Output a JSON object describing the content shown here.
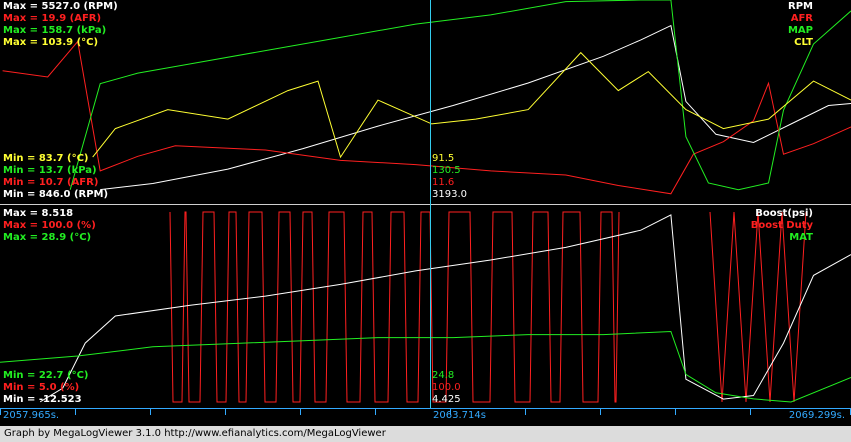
{
  "footer": {
    "text": "Graph by MegaLogViewer 3.1.0 http://www.efianalytics.com/MegaLogViewer"
  },
  "timeline": {
    "start": "2057.965s.",
    "cursor": "2063.714s",
    "end": "2069.299s."
  },
  "top_panel": {
    "max_labels": [
      {
        "text": "Max = 5527.0 (RPM)",
        "color": "#ffffff"
      },
      {
        "text": "Max = 19.9 (AFR)",
        "color": "#ff2020"
      },
      {
        "text": "Max = 158.7 (kPa)",
        "color": "#22ee22"
      },
      {
        "text": "Max = 103.9 (°C)",
        "color": "#ffff33"
      }
    ],
    "min_labels": [
      {
        "text": "Min = 83.7 (°C)",
        "color": "#ffff33"
      },
      {
        "text": "Min = 13.7 (kPa)",
        "color": "#22ee22"
      },
      {
        "text": "Min = 10.7 (AFR)",
        "color": "#ff2020"
      },
      {
        "text": "Min = 846.0 (RPM)",
        "color": "#ffffff"
      }
    ],
    "legend": [
      {
        "text": "RPM",
        "color": "#ffffff"
      },
      {
        "text": "AFR",
        "color": "#ff2020"
      },
      {
        "text": "MAP",
        "color": "#22ee22"
      },
      {
        "text": "CLT",
        "color": "#ffff33"
      }
    ],
    "cursor_values": [
      {
        "text": "91.5",
        "color": "#ffff33"
      },
      {
        "text": "130.5",
        "color": "#22ee22"
      },
      {
        "text": "11.6",
        "color": "#ff2020"
      },
      {
        "text": "3193.0",
        "color": "#ffffff"
      }
    ]
  },
  "bottom_panel": {
    "max_labels": [
      {
        "text": "Max = 8.518",
        "color": "#ffffff"
      },
      {
        "text": "Max = 100.0 (%)",
        "color": "#ff2020"
      },
      {
        "text": "Max = 28.9 (°C)",
        "color": "#22ee22"
      }
    ],
    "min_labels": [
      {
        "text": "Min = 22.7 (°C)",
        "color": "#22ee22"
      },
      {
        "text": "Min = 5.0 (%)",
        "color": "#ff2020"
      },
      {
        "text": "Min = -12.523",
        "color": "#ffffff"
      }
    ],
    "legend": [
      {
        "text": "Boost(psi)",
        "color": "#ffffff"
      },
      {
        "text": "Boost Duty",
        "color": "#ff2020"
      },
      {
        "text": "MAT",
        "color": "#22ee22"
      }
    ],
    "cursor_values": [
      {
        "text": "24.8",
        "color": "#22ee22"
      },
      {
        "text": "100.0",
        "color": "#ff2020"
      },
      {
        "text": "4.425",
        "color": "#ffffff"
      }
    ]
  },
  "chart_data": [
    {
      "type": "line",
      "x_range": [
        2057.965,
        2069.299
      ],
      "cursor_x": 2063.714,
      "series": [
        {
          "name": "RPM",
          "color": "#ffffff",
          "range": [
            846.0,
            5527.0
          ],
          "values": [
            [
              2059.3,
              1050
            ],
            [
              2060,
              1200
            ],
            [
              2061,
              1550
            ],
            [
              2062,
              2050
            ],
            [
              2063,
              2600
            ],
            [
              2064,
              3100
            ],
            [
              2065,
              3650
            ],
            [
              2066,
              4300
            ],
            [
              2066.5,
              4700
            ],
            [
              2066.9,
              5050
            ],
            [
              2067.1,
              3200
            ],
            [
              2067.5,
              2400
            ],
            [
              2068.0,
              2200
            ],
            [
              2068.5,
              2650
            ],
            [
              2069.0,
              3100
            ],
            [
              2069.299,
              3150
            ]
          ]
        },
        {
          "name": "AFR",
          "color": "#ff2020",
          "range": [
            10.7,
            19.9
          ],
          "values": [
            [
              2058.0,
              16.8
            ],
            [
              2058.6,
              16.5
            ],
            [
              2059.0,
              18.2
            ],
            [
              2059.3,
              12.0
            ],
            [
              2059.8,
              12.7
            ],
            [
              2060.3,
              13.2
            ],
            [
              2061.5,
              13.0
            ],
            [
              2062.5,
              12.5
            ],
            [
              2063.5,
              12.3
            ],
            [
              2064.5,
              12.0
            ],
            [
              2065.5,
              11.8
            ],
            [
              2066.2,
              11.3
            ],
            [
              2066.9,
              10.9
            ],
            [
              2067.2,
              12.8
            ],
            [
              2067.6,
              13.4
            ],
            [
              2068.0,
              14.4
            ],
            [
              2068.2,
              16.2
            ],
            [
              2068.4,
              12.8
            ],
            [
              2068.8,
              13.3
            ],
            [
              2069.299,
              14.1
            ]
          ]
        },
        {
          "name": "MAP",
          "color": "#22ee22",
          "range": [
            13.7,
            158.7
          ],
          "values": [
            [
              2058.9,
              20
            ],
            [
              2059.3,
              100
            ],
            [
              2059.8,
              108
            ],
            [
              2060.5,
              115
            ],
            [
              2061.5,
              125
            ],
            [
              2062.5,
              135
            ],
            [
              2063.5,
              145
            ],
            [
              2064.5,
              152
            ],
            [
              2065.5,
              162
            ],
            [
              2066.5,
              175
            ],
            [
              2066.9,
              185
            ],
            [
              2067.1,
              60
            ],
            [
              2067.4,
              25
            ],
            [
              2067.8,
              20
            ],
            [
              2068.2,
              25
            ],
            [
              2068.4,
              80
            ],
            [
              2068.8,
              130
            ],
            [
              2069.299,
              155
            ]
          ]
        },
        {
          "name": "CLT",
          "color": "#ffff33",
          "range": [
            83.7,
            103.9
          ],
          "values": [
            [
              2059.2,
              88
            ],
            [
              2059.5,
              91
            ],
            [
              2060.2,
              93
            ],
            [
              2061,
              92
            ],
            [
              2061.8,
              95
            ],
            [
              2062.2,
              96
            ],
            [
              2062.5,
              88
            ],
            [
              2063,
              94
            ],
            [
              2063.714,
              91.5
            ],
            [
              2064.3,
              92
            ],
            [
              2065,
              93
            ],
            [
              2065.7,
              99
            ],
            [
              2066.2,
              95
            ],
            [
              2066.6,
              97
            ],
            [
              2067.1,
              93
            ],
            [
              2067.6,
              91
            ],
            [
              2068.2,
              92
            ],
            [
              2068.8,
              96
            ],
            [
              2069.299,
              94
            ]
          ]
        }
      ]
    },
    {
      "type": "line",
      "x_range": [
        2057.965,
        2069.299
      ],
      "cursor_x": 2063.714,
      "series": [
        {
          "name": "Boost(psi)",
          "color": "#ffffff",
          "range": [
            -12.523,
            8.518
          ],
          "values": [
            [
              2058.5,
              -12.5
            ],
            [
              2058.8,
              -11
            ],
            [
              2059.1,
              -6
            ],
            [
              2059.5,
              -3
            ],
            [
              2060.5,
              -1.8
            ],
            [
              2061.5,
              -0.8
            ],
            [
              2062.5,
              0.5
            ],
            [
              2063.5,
              2
            ],
            [
              2064.5,
              3.2
            ],
            [
              2065.5,
              4.6
            ],
            [
              2066.5,
              6.5
            ],
            [
              2066.9,
              8.2
            ],
            [
              2067.1,
              -10
            ],
            [
              2067.6,
              -12.2
            ],
            [
              2068.0,
              -11.8
            ],
            [
              2068.4,
              -6
            ],
            [
              2068.8,
              1.5
            ],
            [
              2069.299,
              3.8
            ]
          ]
        },
        {
          "name": "Boost Duty",
          "color": "#ff2020",
          "range": [
            5.0,
            100.0
          ],
          "note_values": [
            5.0,
            100.0
          ]
        },
        {
          "name": "MAT",
          "color": "#22ee22",
          "range": [
            22.7,
            28.9
          ],
          "values": [
            [
              2057.965,
              24.0
            ],
            [
              2059,
              24.2
            ],
            [
              2060,
              24.5
            ],
            [
              2061,
              24.6
            ],
            [
              2062,
              24.7
            ],
            [
              2063,
              24.8
            ],
            [
              2064,
              24.8
            ],
            [
              2065,
              24.9
            ],
            [
              2066,
              24.9
            ],
            [
              2066.9,
              25.0
            ],
            [
              2067.1,
              23.6
            ],
            [
              2067.5,
              23.0
            ],
            [
              2068,
              22.8
            ],
            [
              2068.5,
              22.7
            ],
            [
              2069.299,
              23.5
            ]
          ]
        }
      ]
    }
  ]
}
